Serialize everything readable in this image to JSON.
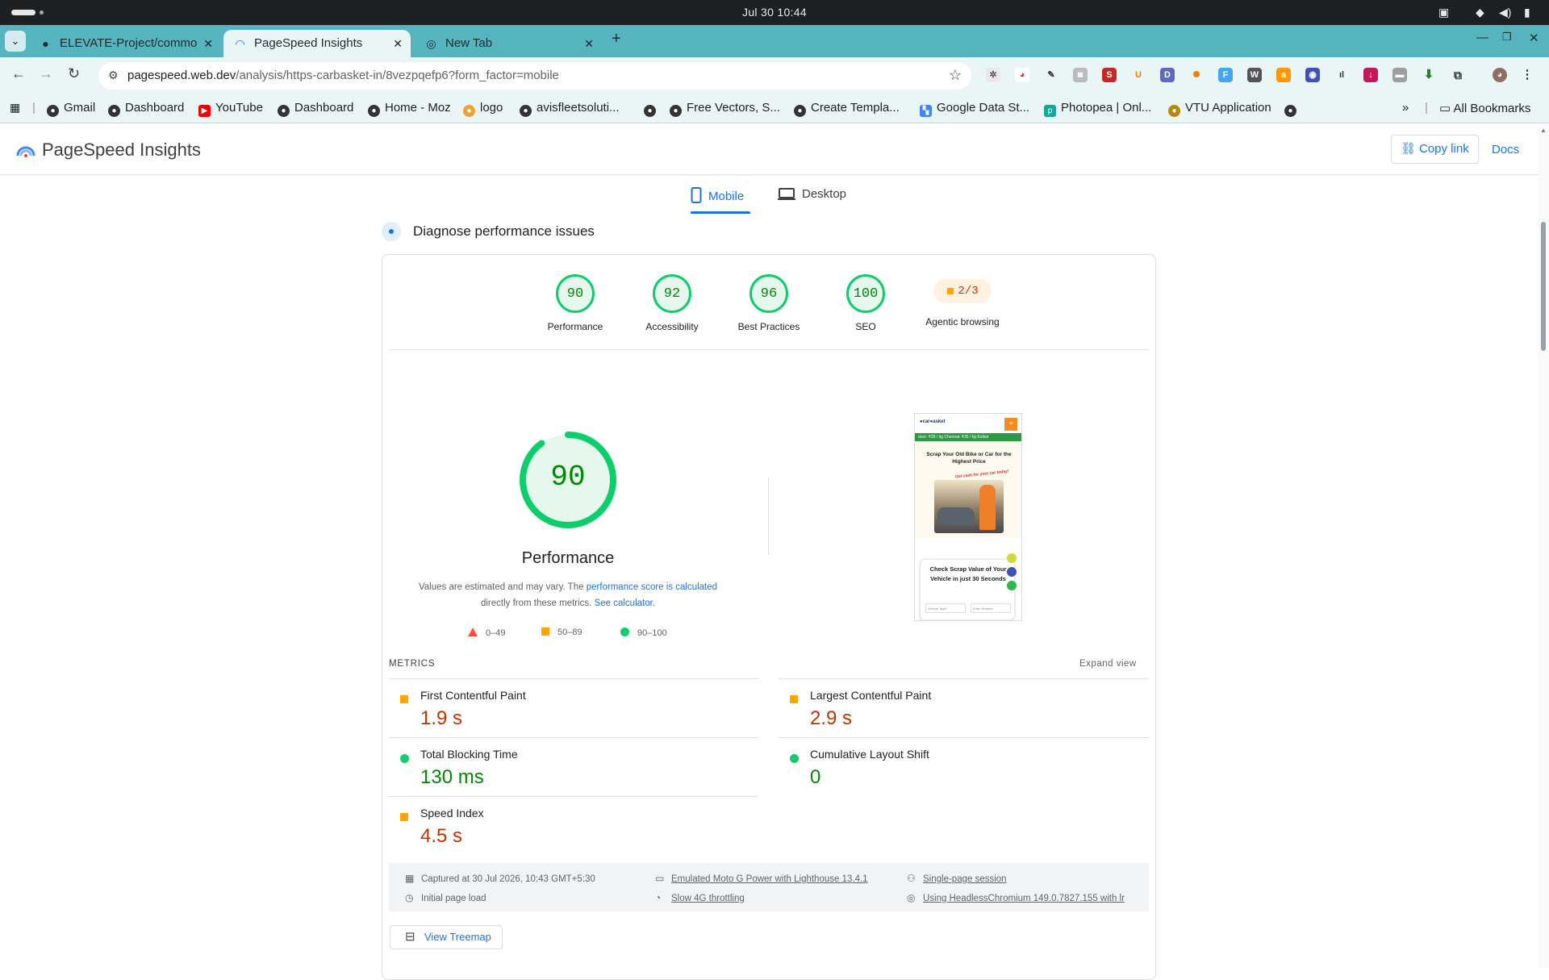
{
  "system_bar": {
    "clock": "Jul 30  10:44"
  },
  "browser": {
    "tabs": [
      {
        "title": "ELEVATE-Project/commo",
        "icon": "github-icon"
      },
      {
        "title": "PageSpeed Insights",
        "icon": "pagespeed-icon",
        "active": true
      },
      {
        "title": "New Tab",
        "icon": "globe-icon"
      }
    ],
    "url_host": "pagespeed.web.dev",
    "url_path": "/analysis/https-carbasket-in/8vezpqefp6?form_factor=mobile",
    "bookmarks": [
      {
        "label": "Gmail"
      },
      {
        "label": "Dashboard"
      },
      {
        "label": "YouTube"
      },
      {
        "label": "Dashboard"
      },
      {
        "label": "Home - Moz"
      },
      {
        "label": "logo"
      },
      {
        "label": "avisfleetsoluti..."
      },
      {
        "label": ""
      },
      {
        "label": "Free Vectors, S..."
      },
      {
        "label": "Create Templa..."
      },
      {
        "label": "Google Data St..."
      },
      {
        "label": "Photopea | Onl..."
      },
      {
        "label": "VTU Application"
      },
      {
        "label": ""
      }
    ],
    "all_bookmarks": "All Bookmarks"
  },
  "psi": {
    "title": "PageSpeed Insights",
    "copy_link": "Copy link",
    "docs": "Docs",
    "device_tabs": {
      "mobile": "Mobile",
      "desktop": "Desktop"
    },
    "section_title": "Diagnose performance issues",
    "categories": [
      {
        "score": "90",
        "label": "Performance"
      },
      {
        "score": "92",
        "label": "Accessibility"
      },
      {
        "score": "96",
        "label": "Best Practices"
      },
      {
        "score": "100",
        "label": "SEO"
      }
    ],
    "agentic": {
      "score": "2/3",
      "label": "Agentic browsing"
    },
    "performance": {
      "score": "90",
      "score_fraction": 0.9,
      "label": "Performance",
      "disclaimer_1": "Values are estimated and may vary. The ",
      "disclaimer_link_1": "performance score is calculated",
      "disclaimer_2": "directly from these metrics. ",
      "disclaimer_link_2": "See calculator.",
      "legend": {
        "fail": "0–49",
        "average": "50–89",
        "pass": "90–100"
      }
    },
    "screenshot": {
      "ticker": "door: ₹35 / kg   Chennai: ₹35 / kg   Kolkat",
      "headline": "Scrap Your Old Bike or Car for the Highest Price",
      "cash_text": "Get cash for your car today!",
      "form_title": "Check Scrap Value of Your Vehicle in just 30 Seconds",
      "field_1": "Vehicle Type*",
      "field_2": "Enter Number"
    },
    "metrics_title": "METRICS",
    "expand_view": "Expand view",
    "metrics": [
      {
        "name": "First Contentful Paint",
        "value": "1.9 s",
        "rating": "average"
      },
      {
        "name": "Largest Contentful Paint",
        "value": "2.9 s",
        "rating": "average"
      },
      {
        "name": "Total Blocking Time",
        "value": "130 ms",
        "rating": "pass"
      },
      {
        "name": "Cumulative Layout Shift",
        "value": "0",
        "rating": "pass"
      },
      {
        "name": "Speed Index",
        "value": "4.5 s",
        "rating": "average"
      }
    ],
    "runtime": {
      "captured": "Captured at 30 Jul 2026, 10:43 GMT+5:30",
      "initial_load": "Initial page load",
      "device": "Emulated Moto G Power with Lighthouse 13.4.1",
      "throttling": "Slow 4G throttling",
      "session": "Single-page session",
      "browser": "Using HeadlessChromium 149.0.7827.155 with lr"
    },
    "view_treemap": "View Treemap"
  },
  "colors": {
    "pass": "#0cce6b",
    "average": "#ffa400",
    "fail": "#ff4e42",
    "link": "#1a73e8",
    "tabstrip": "#56b4bf"
  }
}
